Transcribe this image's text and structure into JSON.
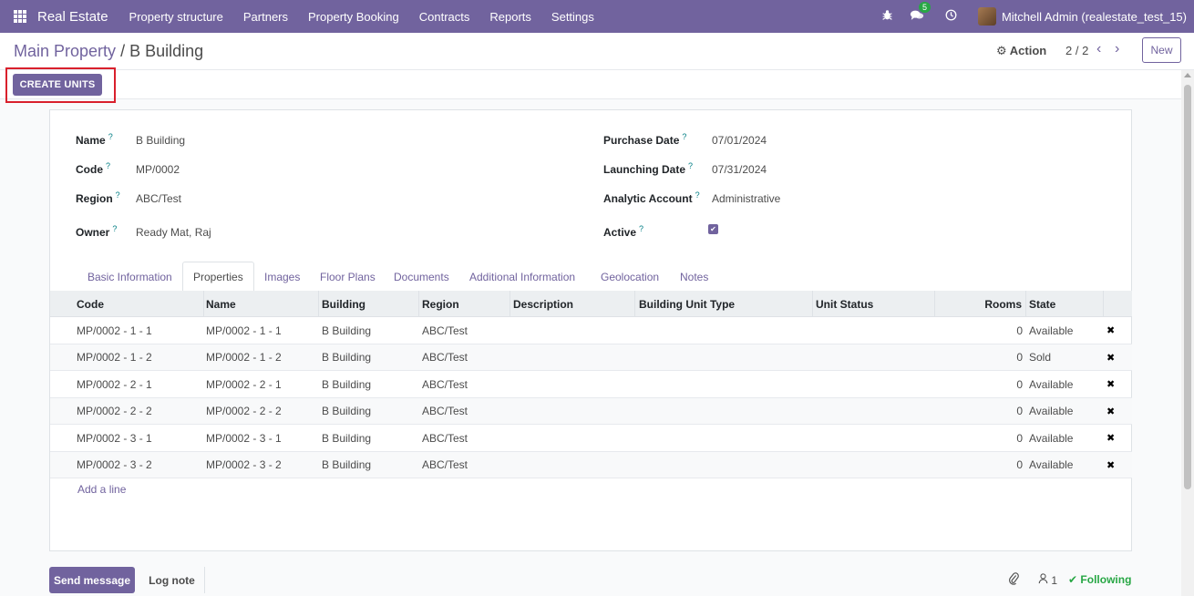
{
  "navbar": {
    "brand": "Real Estate",
    "menu": [
      "Property structure",
      "Partners",
      "Property Booking",
      "Contracts",
      "Reports",
      "Settings"
    ],
    "messages_count": "5",
    "user": "Mitchell Admin (realestate_test_15)"
  },
  "control": {
    "breadcrumb_parent": "Main Property",
    "breadcrumb_sep": "/",
    "breadcrumb_current": "B Building",
    "action_label": "Action",
    "pager": "2 / 2",
    "new_label": "New"
  },
  "buttons": {
    "create_units": "CREATE UNITS"
  },
  "form": {
    "left": [
      {
        "label": "Name",
        "value": "B Building"
      },
      {
        "label": "Code",
        "value": "MP/0002"
      },
      {
        "label": "Region",
        "value": "ABC/Test"
      },
      {
        "label": "Owner",
        "value": "Ready Mat, Raj"
      }
    ],
    "right": [
      {
        "label": "Purchase Date",
        "value": "07/01/2024"
      },
      {
        "label": "Launching Date",
        "value": "07/31/2024"
      },
      {
        "label": "Analytic Account",
        "value": "Administrative"
      },
      {
        "label": "Active",
        "value": ""
      }
    ],
    "help_mark": "?"
  },
  "tabs": [
    "Basic Information",
    "Properties",
    "Images",
    "Floor Plans",
    "Documents",
    "Additional Information",
    "Geolocation",
    "Notes"
  ],
  "table": {
    "headers": [
      "Code",
      "Name",
      "Building",
      "Region",
      "Description",
      "Building Unit Type",
      "Unit Status",
      "Rooms",
      "State"
    ],
    "rows": [
      [
        "MP/0002 - 1 - 1",
        "MP/0002 - 1 - 1",
        "B Building",
        "ABC/Test",
        "",
        "",
        "",
        "0",
        "Available"
      ],
      [
        "MP/0002 - 1 - 2",
        "MP/0002 - 1 - 2",
        "B Building",
        "ABC/Test",
        "",
        "",
        "",
        "0",
        "Sold"
      ],
      [
        "MP/0002 - 2 - 1",
        "MP/0002 - 2 - 1",
        "B Building",
        "ABC/Test",
        "",
        "",
        "",
        "0",
        "Available"
      ],
      [
        "MP/0002 - 2 - 2",
        "MP/0002 - 2 - 2",
        "B Building",
        "ABC/Test",
        "",
        "",
        "",
        "0",
        "Available"
      ],
      [
        "MP/0002 - 3 - 1",
        "MP/0002 - 3 - 1",
        "B Building",
        "ABC/Test",
        "",
        "",
        "",
        "0",
        "Available"
      ],
      [
        "MP/0002 - 3 - 2",
        "MP/0002 - 3 - 2",
        "B Building",
        "ABC/Test",
        "",
        "",
        "",
        "0",
        "Available"
      ]
    ],
    "add_line": "Add a line"
  },
  "chatter": {
    "send_message": "Send message",
    "log_note": "Log note",
    "followers_count": "1",
    "following": "Following"
  },
  "colors": {
    "brand": "#71639e",
    "highlight": "#d9202c",
    "success": "#28a745"
  }
}
